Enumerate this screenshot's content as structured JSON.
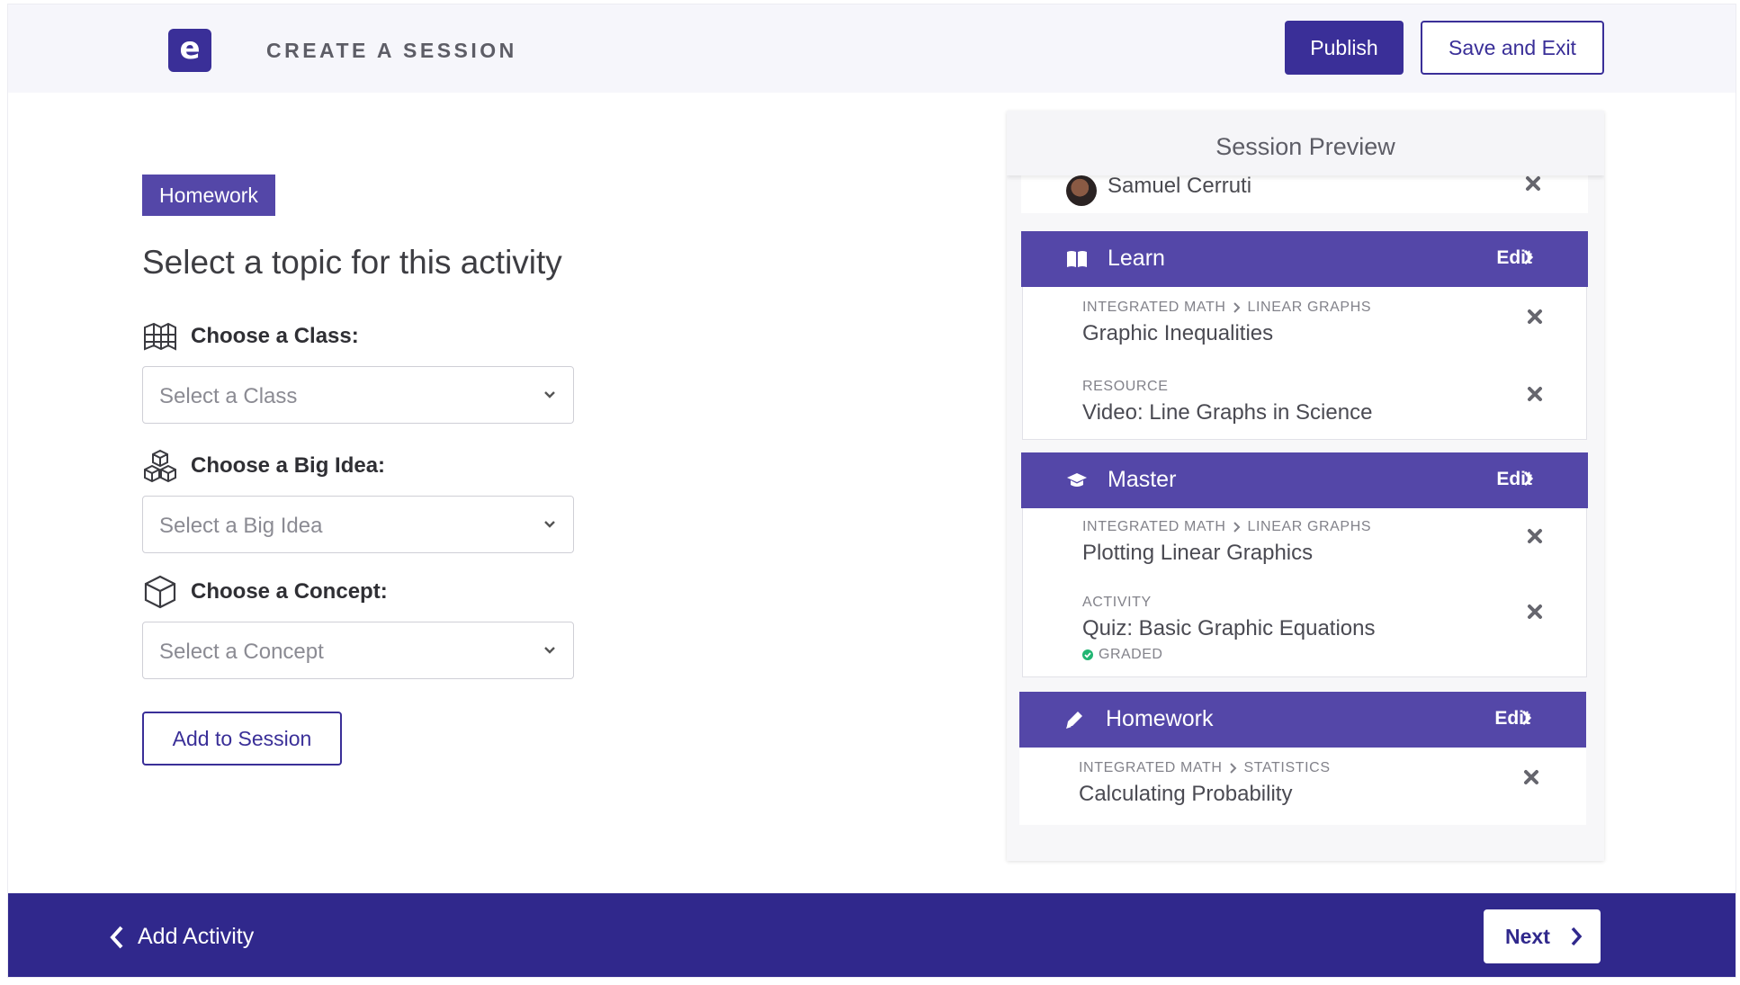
{
  "header": {
    "logo_letter": "e",
    "title": "CREATE A SESSION",
    "publish_label": "Publish",
    "save_exit_label": "Save and Exit"
  },
  "form": {
    "tag": "Homework",
    "heading": "Select a topic for this activity",
    "class": {
      "label": "Choose a Class:",
      "placeholder": "Select a Class",
      "icon": "map-icon"
    },
    "big_idea": {
      "label": "Choose a Big Idea:",
      "placeholder": "Select a Big Idea",
      "icon": "cubes-icon"
    },
    "concept": {
      "label": "Choose a Concept:",
      "placeholder": "Select a Concept",
      "icon": "cube-icon"
    },
    "add_label": "Add to Session"
  },
  "preview": {
    "title": "Session Preview",
    "student": "Samuel Cerruti",
    "edit_label": "Edit",
    "sections": [
      {
        "title": "Learn",
        "icon": "book-icon",
        "items": [
          {
            "crumbs": [
              "INTEGRATED MATH",
              "LINEAR GRAPHS"
            ],
            "title": "Graphic Inequalities"
          },
          {
            "crumbs": [
              "RESOURCE"
            ],
            "title": "Video: Line Graphs in Science"
          }
        ]
      },
      {
        "title": "Master",
        "icon": "graduation-cap-icon",
        "items": [
          {
            "crumbs": [
              "INTEGRATED MATH",
              "LINEAR GRAPHS"
            ],
            "title": "Plotting Linear Graphics"
          },
          {
            "crumbs": [
              "ACTIVITY"
            ],
            "title": "Quiz: Basic Graphic Equations",
            "status": "GRADED"
          }
        ]
      },
      {
        "title": "Homework",
        "icon": "pencil-icon",
        "items": [
          {
            "crumbs": [
              "INTEGRATED MATH",
              "STATISTICS"
            ],
            "title": "Calculating Probability"
          }
        ]
      }
    ]
  },
  "footer": {
    "back_label": "Add Activity",
    "next_label": "Next"
  },
  "colors": {
    "brand": "#3a2f98",
    "section_header": "#5447a8",
    "footer": "#30288c",
    "graded": "#22b573"
  }
}
